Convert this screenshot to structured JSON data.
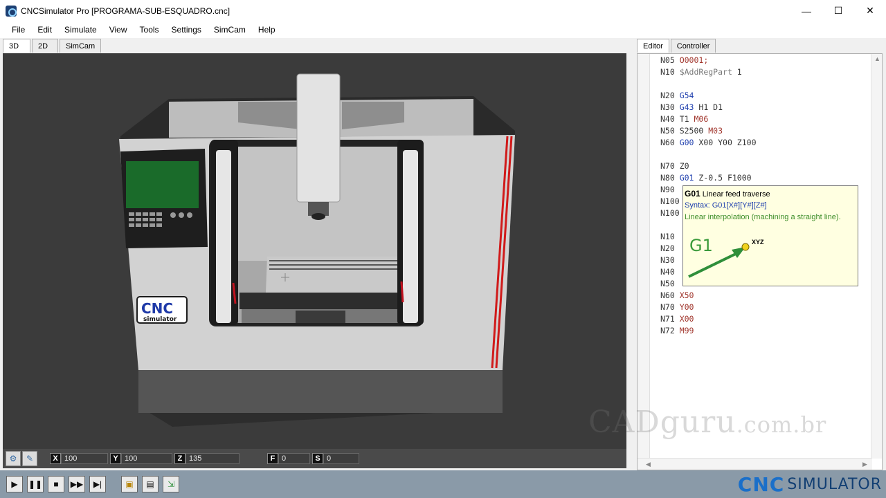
{
  "window": {
    "title": "CNCSimulator Pro [PROGRAMA-SUB-ESQUADRO.cnc]",
    "controls": [
      "—",
      "☐",
      "✕"
    ]
  },
  "menu": [
    "File",
    "Edit",
    "Simulate",
    "View",
    "Tools",
    "Settings",
    "SimCam",
    "Help"
  ],
  "view_tabs": [
    "3D",
    "2D",
    "SimCam"
  ],
  "panel_tabs": [
    "Editor",
    "Controller"
  ],
  "machine": {
    "logo_top": "CNC",
    "logo_bottom": "simulator"
  },
  "coords": {
    "x_label": "X",
    "x_value": "100",
    "y_label": "Y",
    "y_value": "100",
    "z_label": "Z",
    "z_value": "135",
    "f_label": "F",
    "f_value": "0",
    "s_label": "S",
    "s_value": "0"
  },
  "code_lines": [
    [
      {
        "t": "N05 ",
        "c": "ln"
      },
      {
        "t": "O0001;",
        "c": "kw-o"
      }
    ],
    [
      {
        "t": "N10 ",
        "c": "ln"
      },
      {
        "t": "$AddRegPart",
        "c": "kw-var"
      },
      {
        "t": " 1",
        "c": "num"
      }
    ],
    [],
    [
      {
        "t": "N20 ",
        "c": "ln"
      },
      {
        "t": "G54",
        "c": "kw-g"
      }
    ],
    [
      {
        "t": "N30 ",
        "c": "ln"
      },
      {
        "t": "G43",
        "c": "kw-g"
      },
      {
        "t": " H1 D1",
        "c": "num"
      }
    ],
    [
      {
        "t": "N40 ",
        "c": "ln"
      },
      {
        "t": "T1 ",
        "c": "num"
      },
      {
        "t": "M06",
        "c": "kw-m"
      }
    ],
    [
      {
        "t": "N50 ",
        "c": "ln"
      },
      {
        "t": "S2500 ",
        "c": "num"
      },
      {
        "t": "M03",
        "c": "kw-m"
      }
    ],
    [
      {
        "t": "N60 ",
        "c": "ln"
      },
      {
        "t": "G00",
        "c": "kw-g"
      },
      {
        "t": " X00 Y00 Z100",
        "c": "num"
      }
    ],
    [],
    [
      {
        "t": "N70 ",
        "c": "ln"
      },
      {
        "t": "Z0",
        "c": "num"
      }
    ],
    [
      {
        "t": "N80 ",
        "c": "ln"
      },
      {
        "t": "G01",
        "c": "kw-g"
      },
      {
        "t": " Z-0.5 F1000",
        "c": "num"
      }
    ],
    [
      {
        "t": "N90 ",
        "c": "ln"
      }
    ],
    [
      {
        "t": "N100",
        "c": "ln"
      }
    ],
    [
      {
        "t": "N100",
        "c": "ln"
      }
    ],
    [],
    [
      {
        "t": "N10 ",
        "c": "ln"
      }
    ],
    [
      {
        "t": "N20 ",
        "c": "ln"
      }
    ],
    [
      {
        "t": "N30 ",
        "c": "ln"
      }
    ],
    [
      {
        "t": "N40 ",
        "c": "ln"
      }
    ],
    [
      {
        "t": "N50 ",
        "c": "ln"
      }
    ],
    [
      {
        "t": "N60 ",
        "c": "ln"
      },
      {
        "t": "X50",
        "c": "kw-m"
      }
    ],
    [
      {
        "t": "N70 ",
        "c": "ln"
      },
      {
        "t": "Y00",
        "c": "kw-m"
      }
    ],
    [
      {
        "t": "N71 ",
        "c": "ln"
      },
      {
        "t": "X00",
        "c": "kw-m"
      }
    ],
    [
      {
        "t": "N72 ",
        "c": "ln"
      },
      {
        "t": "M99",
        "c": "kw-m"
      }
    ]
  ],
  "tooltip": {
    "code": "G01",
    "name": "Linear feed traverse",
    "syntax": "Syntax: G01[X#][Y#][Z#]",
    "description": "Linear interpolation (machining a straight line).",
    "diagram_label": "G1",
    "diagram_point": "XYZ"
  },
  "watermark": {
    "main": "CADguru",
    "suffix": ".com.br"
  },
  "brand": {
    "cnc": "CNC",
    "simulator": "SIMULATOR"
  },
  "colors": {
    "accent": "#1a6fc9",
    "viewport_bg": "#3b3b3b",
    "tooltip_bg": "#ffffe1"
  }
}
